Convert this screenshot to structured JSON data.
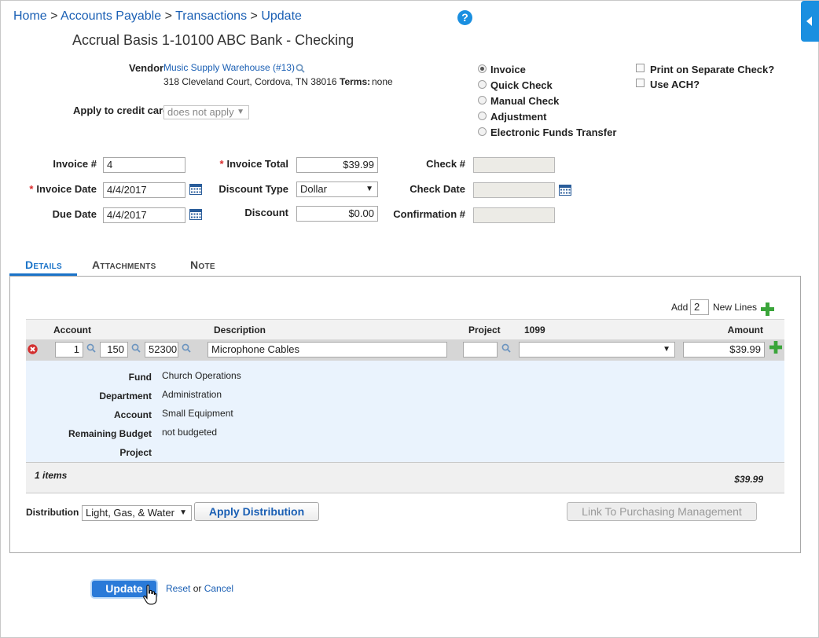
{
  "breadcrumb": {
    "home": "Home",
    "sep1": ">",
    "accounts_payable": "Accounts Payable",
    "sep2": ">",
    "transactions": "Transactions",
    "sep3": ">",
    "current": "Update"
  },
  "help": "?",
  "page_title": "Accrual Basis 1-10100 ABC Bank - Checking",
  "vendor": {
    "label": "Vendor",
    "name": "Music Supply Warehouse (#13)",
    "address": "318 Cleveland Court, Cordova, TN 38016",
    "terms_label": "Terms:",
    "terms_value": "none"
  },
  "credit_card": {
    "label": "Apply to credit card",
    "selected": "does not apply"
  },
  "payment_types": [
    {
      "label": "Invoice",
      "selected": true
    },
    {
      "label": "Quick Check",
      "selected": false
    },
    {
      "label": "Manual Check",
      "selected": false
    },
    {
      "label": "Adjustment",
      "selected": false
    },
    {
      "label": "Electronic Funds Transfer",
      "selected": false
    }
  ],
  "options": {
    "print_separate": "Print on Separate Check?",
    "use_ach": "Use ACH?"
  },
  "form": {
    "required_mark": "*",
    "invoice_num_label": "Invoice #",
    "invoice_num": "4",
    "invoice_date_label": "Invoice Date",
    "invoice_date": "4/4/2017",
    "due_date_label": "Due Date",
    "due_date": "4/4/2017",
    "invoice_total_label": "Invoice Total",
    "invoice_total": "$39.99",
    "discount_type_label": "Discount Type",
    "discount_type": "Dollar",
    "discount_label": "Discount",
    "discount": "$0.00",
    "check_num_label": "Check #",
    "check_date_label": "Check Date",
    "confirmation_label": "Confirmation #"
  },
  "tabs": [
    "Details",
    "Attachments",
    "Note"
  ],
  "add_lines": {
    "add_label": "Add",
    "count": "2",
    "new_lines_label": "New Lines"
  },
  "grid": {
    "headers": {
      "account": "Account",
      "description": "Description",
      "project": "Project",
      "form1099": "1099",
      "amount": "Amount"
    },
    "row": {
      "acct1": "1",
      "acct2": "150",
      "acct3": "52300",
      "description": "Microphone Cables",
      "project": "",
      "form1099": "",
      "amount": "$39.99"
    },
    "detail": {
      "fund_label": "Fund",
      "fund": "Church Operations",
      "department_label": "Department",
      "department": "Administration",
      "account_label": "Account",
      "account": "Small Equipment",
      "budget_label": "Remaining Budget",
      "budget": "not budgeted",
      "project_label": "Project",
      "project": ""
    },
    "footer": {
      "items": "1 items",
      "total": "$39.99"
    }
  },
  "distribution": {
    "label": "Distribution",
    "selected": "Light, Gas, & Water",
    "apply_button": "Apply Distribution",
    "link_button": "Link To Purchasing Management"
  },
  "actions": {
    "update": "Update",
    "reset": "Reset",
    "or": "or",
    "cancel": "Cancel"
  },
  "colors": {
    "link": "#1a5fb4",
    "accent": "#1a8fe0",
    "required": "#d92b2b",
    "add_green": "#3aa53a",
    "remove_red": "#d32f2f"
  }
}
